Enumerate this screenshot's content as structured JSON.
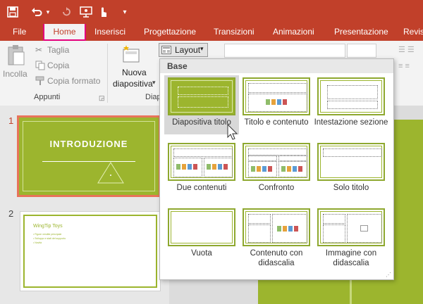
{
  "quick_access": {
    "icons": [
      "save-icon",
      "undo-icon",
      "undo-dropdown-icon",
      "redo-icon",
      "present-from-start-icon",
      "touch-mode-icon",
      "customize-qat-icon"
    ]
  },
  "tabs": [
    {
      "label": "File"
    },
    {
      "label": "Home",
      "active": true
    },
    {
      "label": "Inserisci"
    },
    {
      "label": "Progettazione"
    },
    {
      "label": "Transizioni"
    },
    {
      "label": "Animazioni"
    },
    {
      "label": "Presentazione"
    },
    {
      "label": "Revis"
    }
  ],
  "ribbon": {
    "clipboard": {
      "paste_label": "Incolla",
      "cut_label": "Taglia",
      "copy_label": "Copia",
      "format_painter_label": "Copia formato",
      "group_label": "Appunti"
    },
    "slides": {
      "new_slide_label_1": "Nuova",
      "new_slide_label_2": "diapositiva",
      "layout_label": "Layout",
      "group_label": "Diap"
    }
  },
  "thumbnails": [
    {
      "number": "1",
      "title": "INTRODUZIONE"
    },
    {
      "number": "2",
      "title": "WingTip Toys",
      "bullets": [
        "• Figure vendite principale",
        "• Sviluppo e stati del supporto",
        "• Novità"
      ]
    }
  ],
  "layout_gallery": {
    "header": "Base",
    "items": [
      {
        "label": "Diapositiva titolo",
        "selected": true
      },
      {
        "label": "Titolo e contenuto"
      },
      {
        "label": "Intestazione sezione"
      },
      {
        "label": "Due contenuti"
      },
      {
        "label": "Confronto"
      },
      {
        "label": "Solo titolo"
      },
      {
        "label": "Vuota"
      },
      {
        "label": "Contenuto con didascalia"
      },
      {
        "label": "Immagine con didascalia"
      }
    ]
  },
  "colors": {
    "title_bar": "#c1402a",
    "accent_green": "#9cb52e",
    "selected_outline": "#e4007c",
    "slide_selected_border": "#e8735a"
  }
}
